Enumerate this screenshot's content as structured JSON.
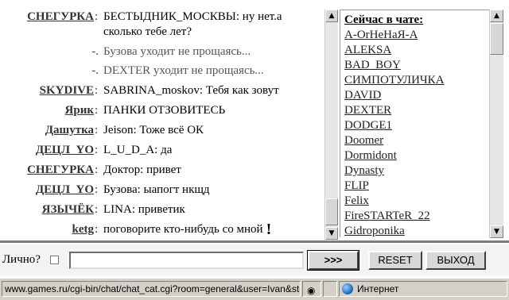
{
  "chat": {
    "messages": [
      {
        "type": "user",
        "nick": "СНЕГУРКА",
        "text": "БЕСТЫДНИК_МОСКВЫ: ну нет.а сколько тебе лет?"
      },
      {
        "type": "system",
        "text": "Бузова уходит не прощаясь..."
      },
      {
        "type": "system",
        "text": "DEXTER уходит не прощаясь..."
      },
      {
        "type": "user",
        "nick": "SKYDIVE",
        "text": "SABRINA_moskov: Тебя как зовут"
      },
      {
        "type": "user",
        "nick": "Ярик",
        "text": "ПАНКИ ОТЗОВИТЕСЬ"
      },
      {
        "type": "user",
        "nick": "Дашутка",
        "text": "Jeison: Тоже всё ОК"
      },
      {
        "type": "user",
        "nick": "ДЕЦЛ_YO",
        "text": "L_U_D_A: да"
      },
      {
        "type": "user",
        "nick": "СНЕГУРКА",
        "text": "Доктор: привет"
      },
      {
        "type": "user",
        "nick": "ДЕЦЛ_YO",
        "text": "Бузова: ыапогт нкщд"
      },
      {
        "type": "user",
        "nick": "ЯЗЫЧЁК",
        "text": "LINA: приветик"
      },
      {
        "type": "user",
        "nick": "ketg",
        "text": "поговорите кто-нибудь со мной",
        "suffix": "!"
      }
    ],
    "separator": ":",
    "system_prefix": "-."
  },
  "userlist": {
    "title": "Сейчас в чате:",
    "users": [
      "A-OrHeHaЯ-A",
      "ALEKSA",
      "BAD_BOY",
      "СИМПОТУЛИЧКА",
      "DAVID",
      "DEXTER",
      "DODGE1",
      "Doomer",
      "Dormidont",
      "Dynasty",
      "FLIP",
      "Felix",
      "FireSTARTeR_22",
      "Gidroponika"
    ]
  },
  "input": {
    "private_label": "Лично?",
    "message_value": "",
    "send_label": ">>>",
    "reset_label": "RESET",
    "exit_label": "ВЫХОД"
  },
  "statusbar": {
    "url": "www.games.ru/cgi-bin/chat/chat_cat.cgi?room=general&user=Ivan&sto",
    "zone": "Интернет"
  },
  "icons": {
    "scroll_up": "arrow-up-icon",
    "scroll_down": "arrow-down-icon",
    "security": "eye-icon",
    "zone": "globe-icon"
  }
}
